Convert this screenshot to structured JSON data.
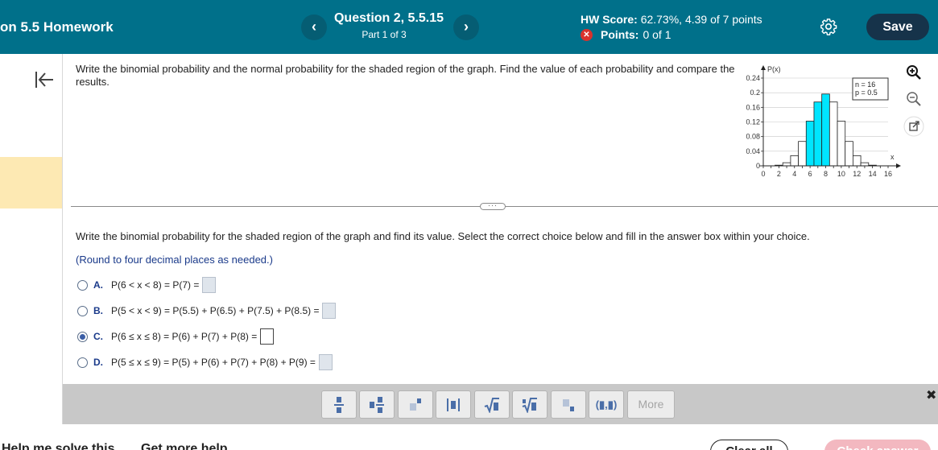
{
  "header": {
    "assignment_title": "on 5.5 Homework",
    "question_title": "Question 2, 5.5.15",
    "part_label": "Part 1 of 3",
    "prev_glyph": "‹",
    "next_glyph": "›",
    "hw_score_label": "HW Score:",
    "hw_score_value": "62.73%, 4.39 of 7 points",
    "points_label": "Points:",
    "points_value": "0 of 1",
    "save_label": "Save",
    "colors": {
      "bar": "#00708a",
      "save": "#16334a",
      "error": "#d9322d"
    }
  },
  "question": {
    "instruction": "Write the binomial probability and the normal probability for the shaded region of the graph. Find the value of each probability and compare the results.",
    "part_prompt": "Write the binomial probability for the shaded region of the graph and find its value. Select the correct choice below and fill in the answer box within your choice.",
    "round_note": "(Round to four decimal places as needed.)",
    "choices": [
      {
        "letter": "A.",
        "expr": "P(6 < x < 8) = P(7) =",
        "selected": false
      },
      {
        "letter": "B.",
        "expr": "P(5 < x < 9) = P(5.5) + P(6.5) + P(7.5) + P(8.5) =",
        "selected": false
      },
      {
        "letter": "C.",
        "expr": "P(6 ≤ x ≤ 8) = P(6) + P(7) + P(8) =",
        "selected": true
      },
      {
        "letter": "D.",
        "expr": "P(5 ≤ x ≤ 9) = P(5) + P(6) + P(7) + P(8) + P(9) =",
        "selected": false
      }
    ]
  },
  "chart_data": {
    "type": "bar",
    "ylabel": "P(x)",
    "xlabel": "x",
    "legend": [
      "n = 16",
      "p = 0.5"
    ],
    "x_ticks": [
      "0",
      "2",
      "4",
      "6",
      "8",
      "10",
      "12",
      "14",
      "16"
    ],
    "y_ticks": [
      "0",
      "0.04",
      "0.08",
      "0.12",
      "0.16",
      "0.2",
      "0.24"
    ],
    "ylim": [
      0,
      0.24
    ],
    "xlim": [
      0,
      16
    ],
    "x": [
      0,
      1,
      2,
      3,
      4,
      5,
      6,
      7,
      8,
      9,
      10,
      11,
      12,
      13,
      14,
      15,
      16
    ],
    "values": [
      0.0,
      0.0002,
      0.0018,
      0.0085,
      0.0278,
      0.0667,
      0.1222,
      0.1746,
      0.1964,
      0.1746,
      0.1222,
      0.0667,
      0.0278,
      0.0085,
      0.0018,
      0.0002,
      0.0
    ],
    "shaded_x": [
      6,
      7,
      8
    ],
    "shade_color": "#00e5ff"
  },
  "toolbar": {
    "tools": [
      "fraction-tool",
      "mixed-number-tool",
      "exponent-tool",
      "absolute-value-tool",
      "square-root-tool",
      "nth-root-tool",
      "subscript-tool",
      "ordered-pair-tool"
    ],
    "ordered_pair_label": "(▮,▮)",
    "more_label": "More",
    "close_glyph": "✖"
  },
  "footer": {
    "help_solve": "Help me solve this",
    "more_help": "Get more help",
    "clear_all": "Clear all",
    "check_answer": "Check answer"
  }
}
